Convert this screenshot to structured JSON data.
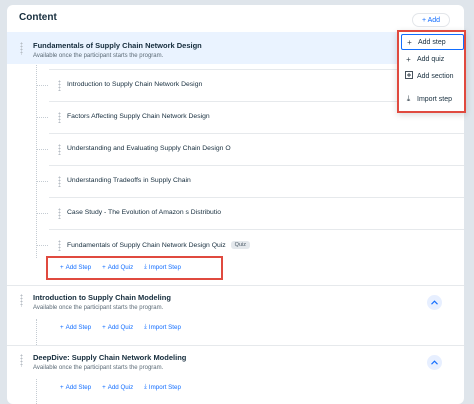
{
  "header": {
    "title": "Content",
    "add_label": "+ Add"
  },
  "sections": [
    {
      "title": "Fundamentals of Supply Chain Network Design",
      "subtitle": "Available once the participant starts the program.",
      "steps": [
        "Introduction to Supply Chain Network Design",
        "Factors Affecting Supply Chain Network Design",
        "Understanding and Evaluating Supply Chain Design O",
        "Understanding Tradeoffs in Supply Chain",
        "Case Study - The Evolution of Amazon s Distributio",
        "Fundamentals of Supply Chain Network Design Quiz"
      ],
      "quiz_badge": "Quiz"
    },
    {
      "title": "Introduction to Supply Chain Modeling",
      "subtitle": "Available once the participant starts the program."
    },
    {
      "title": "DeepDive: Supply Chain Network Modeling",
      "subtitle": "Available once the participant starts the program."
    }
  ],
  "actions": {
    "add_step": "Add Step",
    "add_quiz": "Add Quiz",
    "import_step": "Import Step"
  },
  "menu": {
    "items": [
      "Add step",
      "Add quiz",
      "Add section",
      "Import step"
    ]
  },
  "colors": {
    "accent": "#116dff",
    "highlight": "#e04a3f",
    "active_bg": "#eaf3ff"
  }
}
